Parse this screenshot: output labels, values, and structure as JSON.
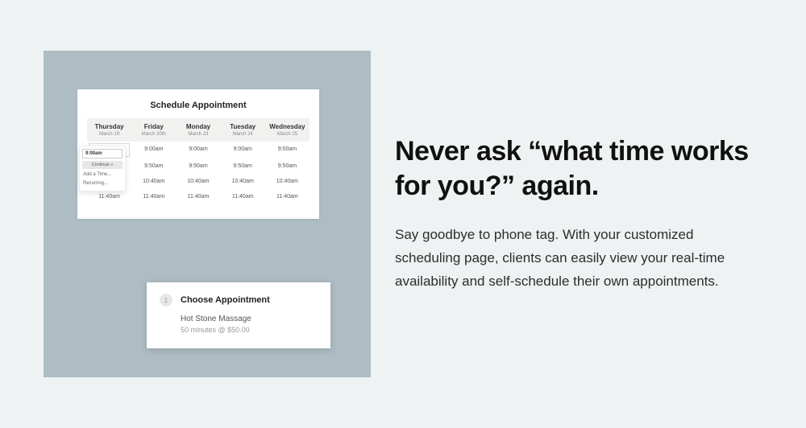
{
  "marketing": {
    "headline": "Never ask “what time works for you?” again.",
    "body": "Say goodbye to phone tag. With your customized scheduling page, clients can easily view your real-time availability and self-schedule their own appointments."
  },
  "schedule": {
    "title": "Schedule Appointment",
    "days": [
      {
        "dow": "Thursday",
        "date": "March 19"
      },
      {
        "dow": "Friday",
        "date": "March 20th"
      },
      {
        "dow": "Monday",
        "date": "March 23"
      },
      {
        "dow": "Tuesday",
        "date": "March 24"
      },
      {
        "dow": "Wednesday",
        "date": "March 25"
      }
    ],
    "rows": [
      "9:00am",
      "9:50am",
      "10:40am",
      "11:40am"
    ],
    "selected": {
      "day": 0,
      "row": 0
    },
    "picker": {
      "selected": "9:00am",
      "continue": "Continue »",
      "addTime": "Add a Time...",
      "recurring": "Recurring..."
    }
  },
  "choose": {
    "stepNum": "1",
    "stepTitle": "Choose Appointment",
    "service": "Hot Stone Massage",
    "meta": "50 minutes @ $50.00"
  }
}
